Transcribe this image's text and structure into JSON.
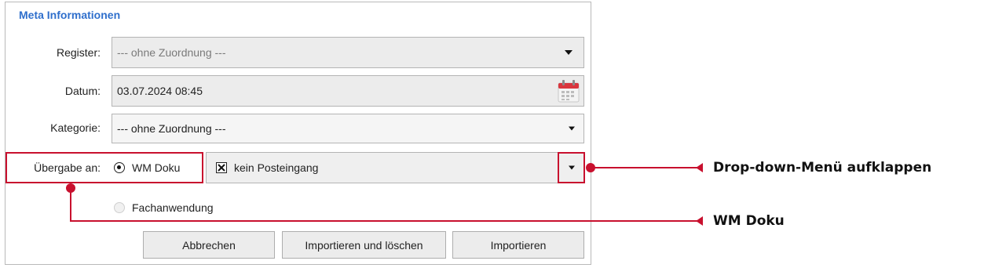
{
  "panel": {
    "title": "Meta Informationen"
  },
  "register": {
    "label": "Register:",
    "value": "--- ohne Zuordnung ---"
  },
  "datum": {
    "label": "Datum:",
    "value": "03.07.2024 08:45"
  },
  "kategorie": {
    "label": "Kategorie:",
    "value": "--- ohne Zuordnung ---"
  },
  "uebergabe": {
    "label": "Übergabe an:",
    "option_wm": "WM Doku",
    "option_fach": "Fachanwendung",
    "selected": "WM Doku",
    "dropdown_value": "kein Posteingang"
  },
  "buttons": {
    "cancel": "Abbrechen",
    "import_delete": "Importieren und löschen",
    "import": "Importieren"
  },
  "annotations": {
    "dropdown": "Drop-down-Menü aufklappen",
    "wm": "WM Doku"
  },
  "colors": {
    "title": "#2f6fcc",
    "annotation": "#c8102e",
    "calendar": "#d9363e"
  }
}
